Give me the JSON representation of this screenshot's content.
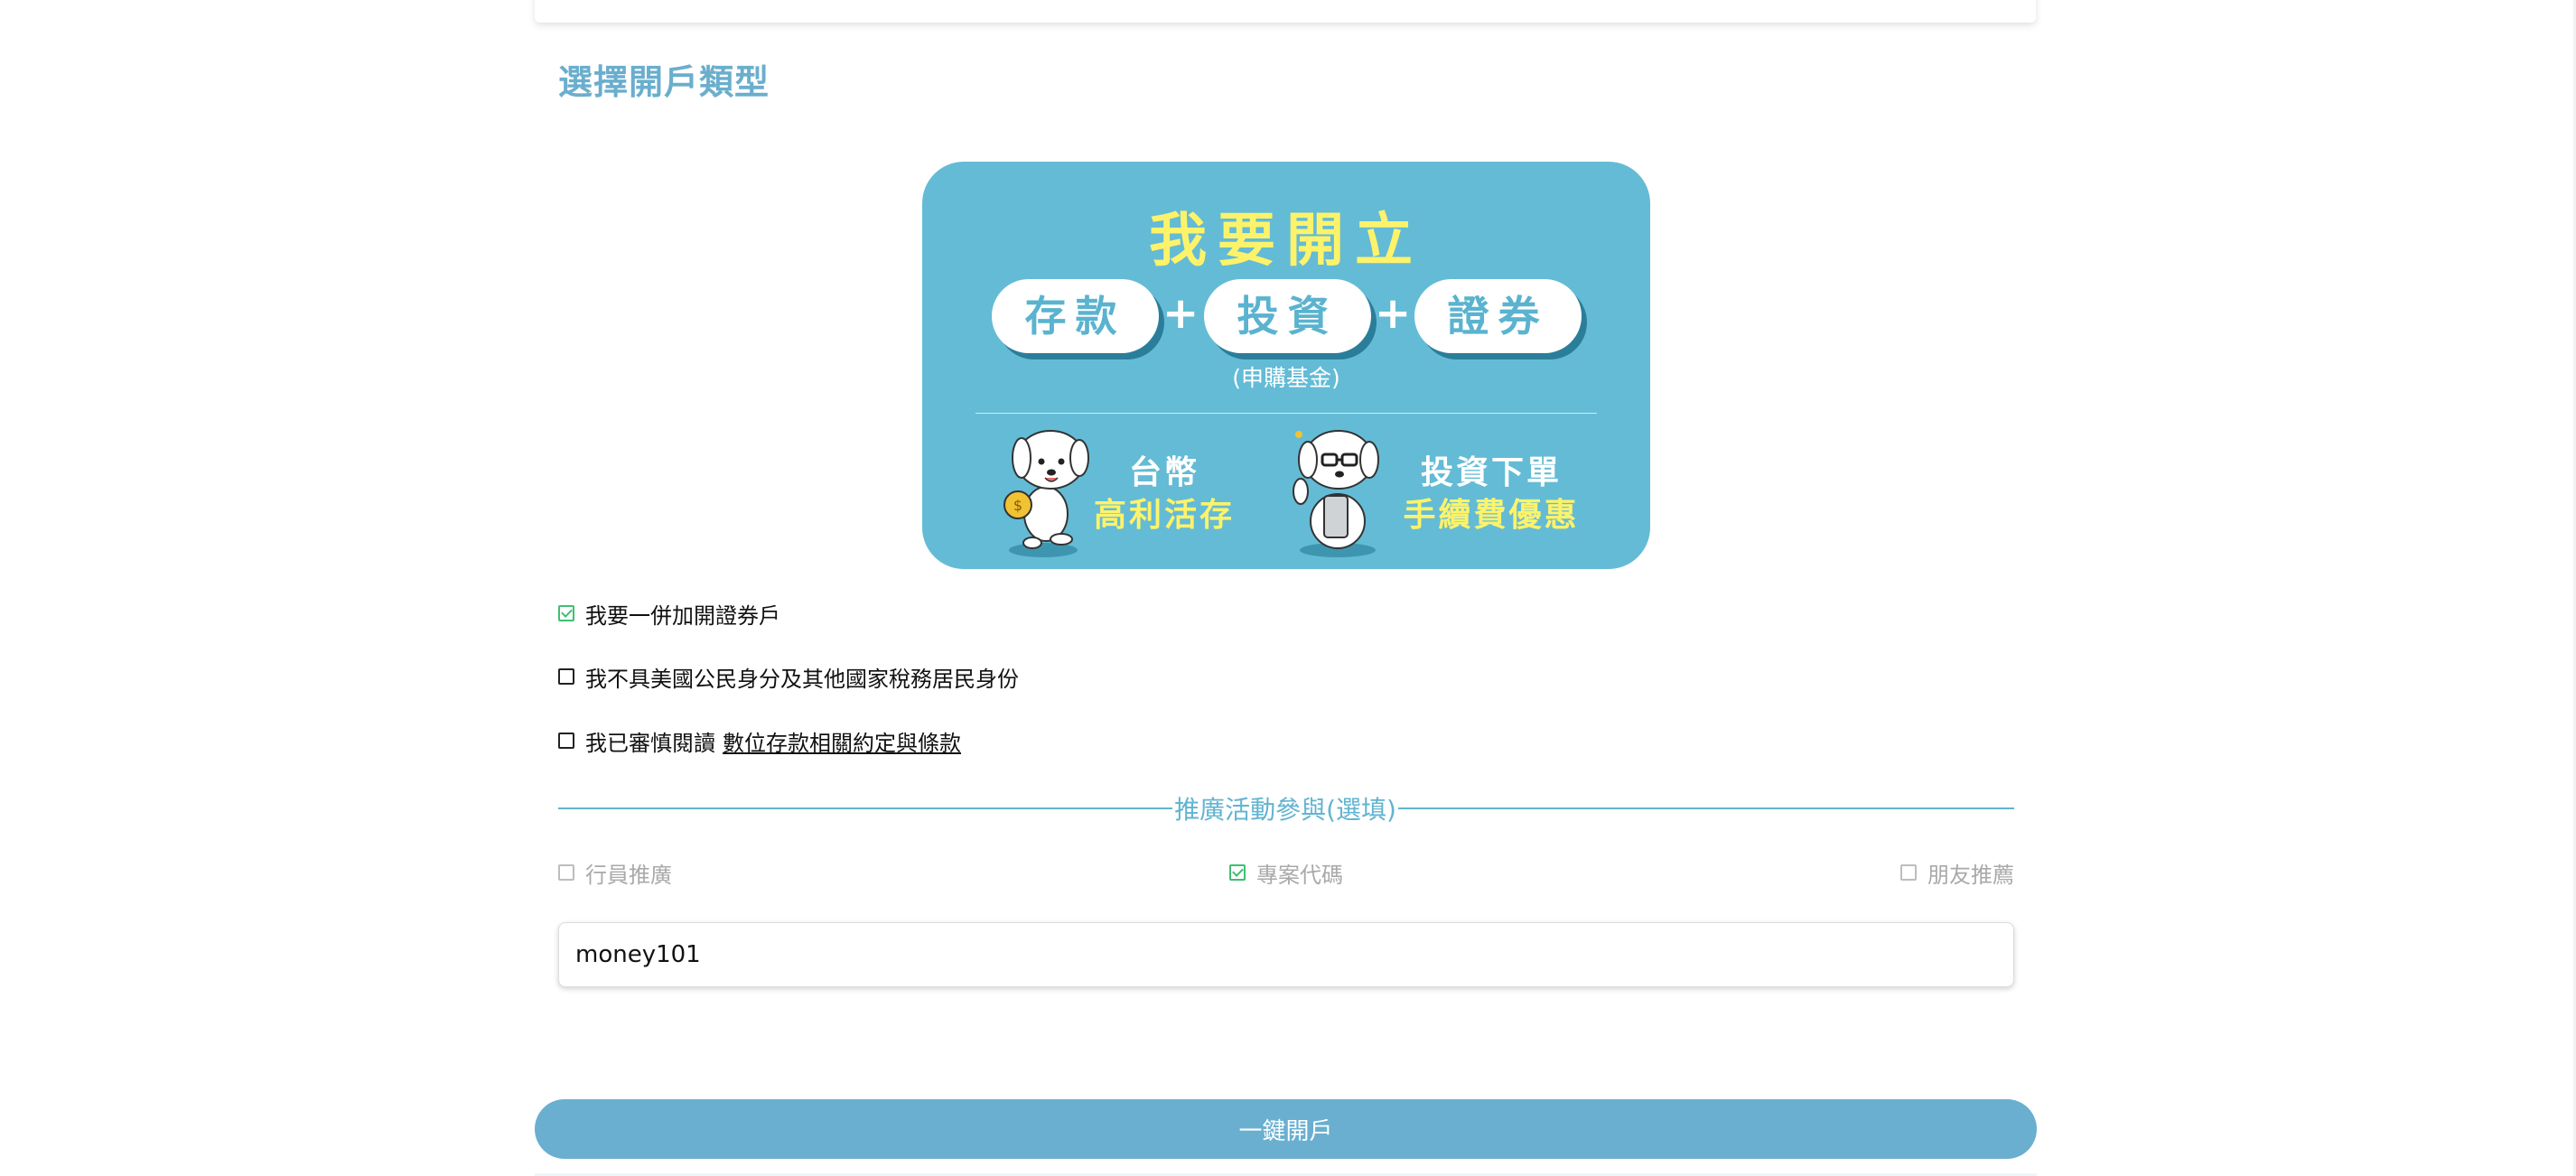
{
  "page": {
    "title": "選擇開戶類型"
  },
  "banner": {
    "headline": "我要開立",
    "pills": [
      "存款",
      "投資",
      "證券"
    ],
    "plus": "+",
    "pill_sub": "(申購基金)",
    "features": [
      {
        "top": "台幣",
        "bottom": "高利活存",
        "icon": "dog-coin-mascot"
      },
      {
        "top": "投資下單",
        "bottom": "手續費優惠",
        "icon": "dog-phone-mascot"
      }
    ],
    "colors": {
      "background": "#64bbd5",
      "headline": "#fdf36a",
      "pill_text": "#5ab3cf"
    }
  },
  "agreements": [
    {
      "label": "我要一併加開證券戶",
      "checked": true
    },
    {
      "label": "我不具美國公民身分及其他國家稅務居民身份",
      "checked": false
    },
    {
      "label": "我已審慎閱讀",
      "link": "數位存款相關約定與條款",
      "checked": false
    }
  ],
  "promotion": {
    "section_title": "推廣活動參與(選填)",
    "options": [
      {
        "label": "行員推廣",
        "checked": false
      },
      {
        "label": "專案代碼",
        "checked": true
      },
      {
        "label": "朋友推薦",
        "checked": false
      }
    ],
    "code_value": "money101"
  },
  "submit": {
    "label": "一鍵開戶",
    "color": "#6aafd0"
  },
  "colors": {
    "accent": "#62b4d0",
    "check": "#3fbf71"
  }
}
